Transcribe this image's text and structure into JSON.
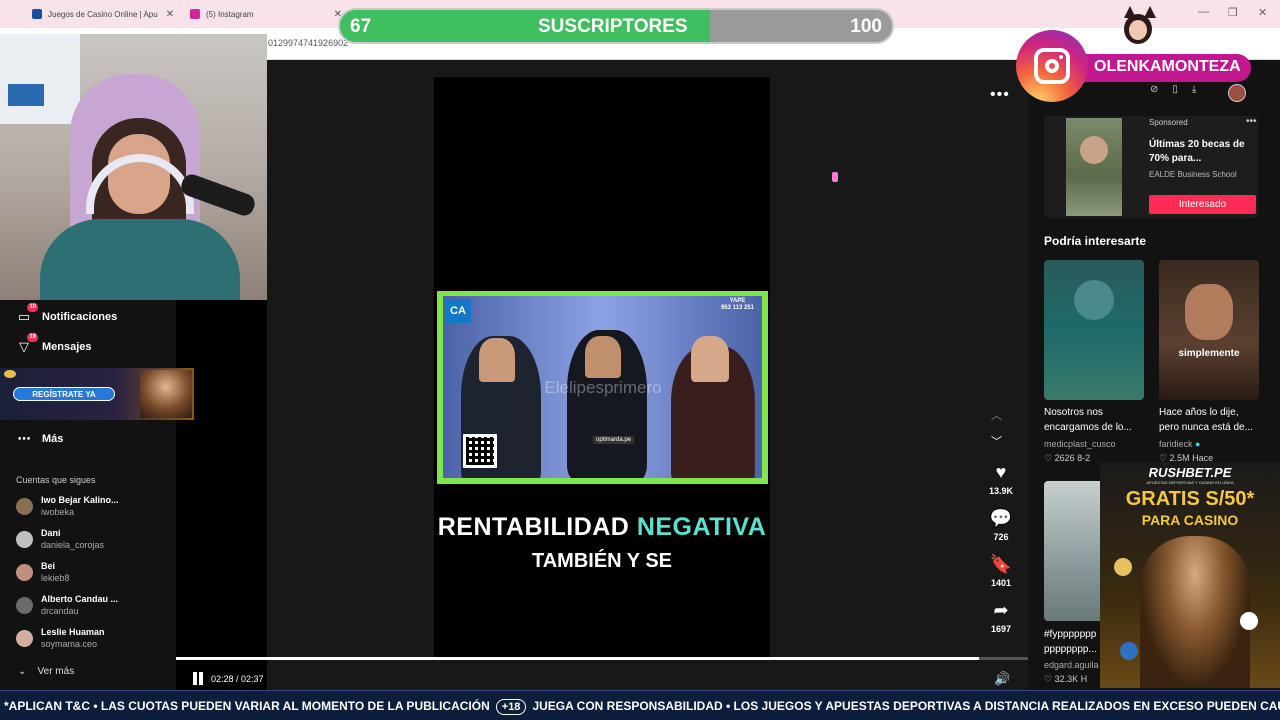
{
  "browser": {
    "tabs": [
      {
        "title": "Juegos de Casino Online | Apu"
      },
      {
        "title": "(5) Instagram"
      }
    ],
    "address_fragment": "0129974741926902"
  },
  "overlay": {
    "subs_current": "67",
    "subs_label": "SUSCRIPTORES",
    "subs_goal": "100",
    "subs_progress": 0.67,
    "instagram_handle": "OLENKAMONTEZA",
    "colors": {
      "accent_green": "#3fbf5f",
      "tiktok_red": "#fe2c55"
    }
  },
  "sidebar": {
    "nav": [
      {
        "label": "Notificaciones",
        "badge": "10",
        "icon": "bell-icon"
      },
      {
        "label": "Mensajes",
        "badge": "19",
        "icon": "paper-plane-icon"
      },
      {
        "label": "Más",
        "icon": "more-dots-icon"
      }
    ],
    "register_ad_label": "REGÍSTRATE YA",
    "following_title": "Cuentas que sigues",
    "following": [
      {
        "name": "Iwo Bejar Kalino...",
        "handle": "iwobeka"
      },
      {
        "name": "Dani",
        "handle": "daniela_corojas"
      },
      {
        "name": "Bei",
        "handle": "lekieb8"
      },
      {
        "name": "Alberto Candau ...",
        "handle": "drcandau"
      },
      {
        "name": "Leslie Huaman",
        "handle": "soymama.ceo"
      }
    ],
    "see_more": "Ver más"
  },
  "video": {
    "clip_logo": "CA",
    "clip_yape": "YAPE\n953 113 251",
    "clip_watermark": "Elelipesprimero",
    "clip_banner": "optimarda.pe",
    "caption_line1_a": "RENTABILIDAD",
    "caption_line1_b": "NEGATIVA",
    "caption_line2": "TAMBIÉN Y SE",
    "time": "02:28 / 02:37",
    "progress": 0.943,
    "actions": [
      {
        "icon": "heart-icon",
        "count": "13.9K"
      },
      {
        "icon": "comment-icon",
        "count": "726"
      },
      {
        "icon": "bookmark-icon",
        "count": "1401"
      },
      {
        "icon": "share-icon",
        "count": "1697"
      }
    ]
  },
  "right_panel": {
    "ad": {
      "sponsored": "Sponsored",
      "title": "Últimas 20 becas de 70% para...",
      "brand": "EALDE Business School",
      "cta": "Interesado"
    },
    "section_title": "Podría interesarte",
    "recommendations": [
      {
        "title": "Nosotros nos encargamos de lo...",
        "author": "medicplast_cusco",
        "likes": "2626",
        "age": "8-2",
        "overlay": ""
      },
      {
        "title": "Hace años lo dije, pero nunca está de...",
        "author": "faridieck",
        "likes": "2.5M",
        "age": "Hace",
        "overlay": "simplemente"
      },
      {
        "title": "#fyppppppp pppppppp...",
        "author": "edgard.aguila",
        "likes": "32.3K",
        "age": "H",
        "overlay": ""
      }
    ]
  },
  "rushbet_ad": {
    "logo": "RUSHBET.PE",
    "subtitle": "APUESTAS DEPORTIVAS Y CASINO EN LÍNEA",
    "gratis": "GRATIS S/50*",
    "para": "PARA CASINO"
  },
  "ticker": {
    "text_a": "*APLICAN T&C • LAS CUOTAS PUEDEN VARIAR AL MOMENTO DE LA PUBLICACIÓN",
    "badge": "+18",
    "text_b": "JUEGA CON RESPONSABILIDAD • LOS JUEGOS Y APUESTAS DEPORTIVAS A DISTANCIA REALIZADOS EN EXCESO PUEDEN CAUSAR LUDOPATÍA • PROHIBIDO A MENORES DE EDAD."
  }
}
